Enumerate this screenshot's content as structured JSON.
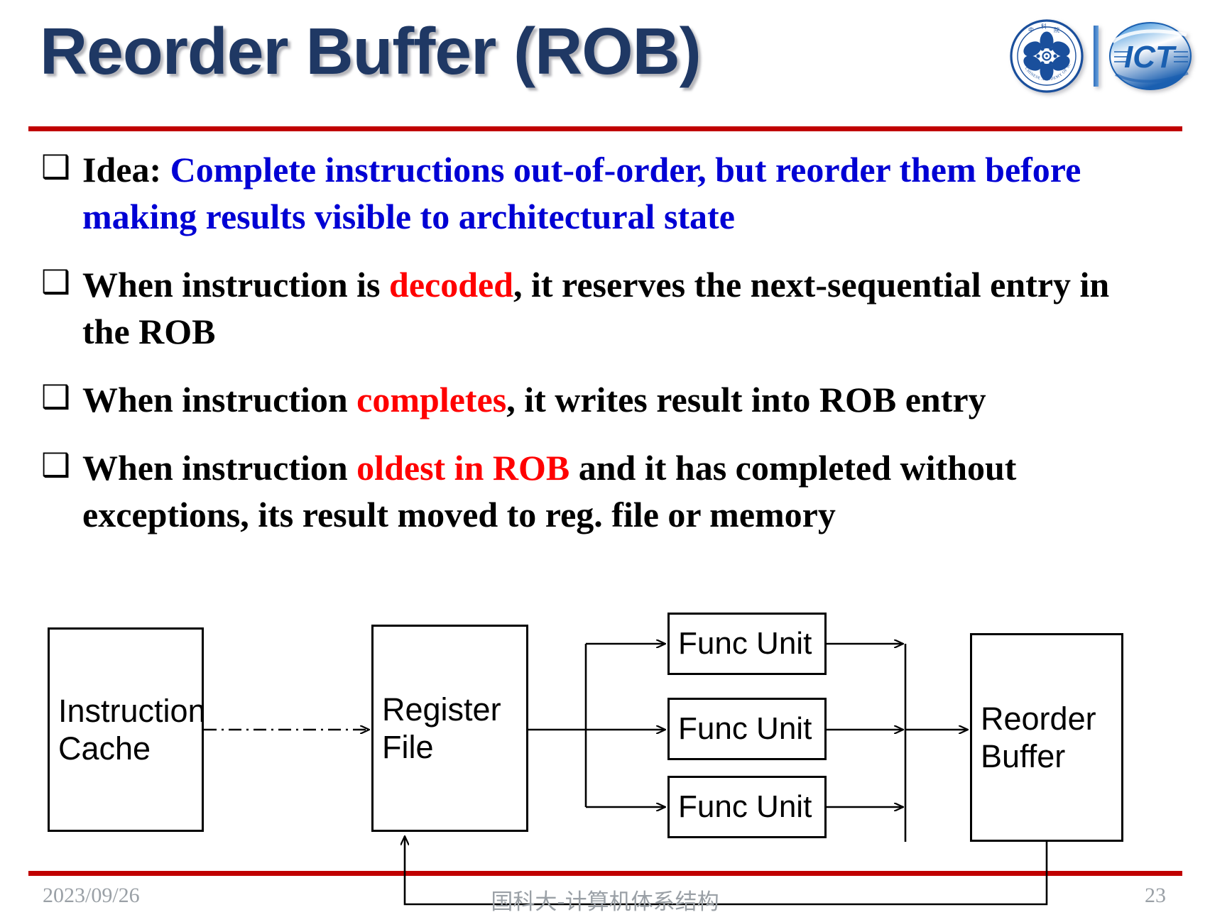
{
  "slide": {
    "title": "Reorder Buffer (ROB)",
    "accent_red": "#c00000",
    "title_color": "#1f3864",
    "highlight_blue": "#0000d4",
    "highlight_red": "#ff0000"
  },
  "logos": [
    {
      "name": "chinese-academy-of-sciences-logo",
      "caption": "CHINESE ACADEMY OF SCIENCES"
    },
    {
      "name": "ict-logo",
      "caption": "ICT"
    }
  ],
  "bullets": [
    {
      "marker": "❑",
      "runs": [
        {
          "text": "Idea: ",
          "color": "black"
        },
        {
          "text": "Complete instructions out-of-order, but reorder them before making results visible to architectural state",
          "color": "blue"
        }
      ]
    },
    {
      "marker": "❑",
      "runs": [
        {
          "text": "When instruction is ",
          "color": "black"
        },
        {
          "text": "decoded",
          "color": "red"
        },
        {
          "text": ", it reserves the next-sequential entry in the ROB",
          "color": "black"
        }
      ]
    },
    {
      "marker": "❑",
      "runs": [
        {
          "text": "When instruction ",
          "color": "black"
        },
        {
          "text": "completes",
          "color": "red"
        },
        {
          "text": ", it writes result into ROB entry",
          "color": "black"
        }
      ]
    },
    {
      "marker": "❑",
      "runs": [
        {
          "text": "When instruction ",
          "color": "black"
        },
        {
          "text": "oldest in ROB",
          "color": "red"
        },
        {
          "text": " and it has completed without exceptions, its result moved to reg. file or memory",
          "color": "black"
        }
      ]
    }
  ],
  "diagram": {
    "boxes": {
      "instruction_cache": "Instruction\nCache",
      "register_file": "Register\nFile",
      "func_unit_1": "Func Unit",
      "func_unit_2": "Func Unit",
      "func_unit_3": "Func Unit",
      "reorder_buffer": "Reorder\nBuffer"
    },
    "connections": [
      {
        "from": "instruction_cache",
        "to": "register_file",
        "style": "dash-dot",
        "arrow": true
      },
      {
        "from": "register_file",
        "to": "func_unit_1",
        "style": "solid",
        "arrow": true
      },
      {
        "from": "register_file",
        "to": "func_unit_2",
        "style": "solid",
        "arrow": true
      },
      {
        "from": "register_file",
        "to": "func_unit_3",
        "style": "solid",
        "arrow": true
      },
      {
        "from": "func_unit_1",
        "to": "reorder_buffer",
        "style": "solid",
        "arrow": true
      },
      {
        "from": "func_unit_2",
        "to": "reorder_buffer",
        "style": "solid",
        "arrow": true
      },
      {
        "from": "func_unit_3",
        "to": "reorder_buffer",
        "style": "solid",
        "arrow": true
      },
      {
        "from": "reorder_buffer",
        "to": "register_file",
        "style": "solid",
        "arrow": true,
        "route": "feedback-bottom"
      }
    ]
  },
  "footer": {
    "date": "2023/09/26",
    "center": "国科大-计算机体系结构",
    "page": "23"
  }
}
